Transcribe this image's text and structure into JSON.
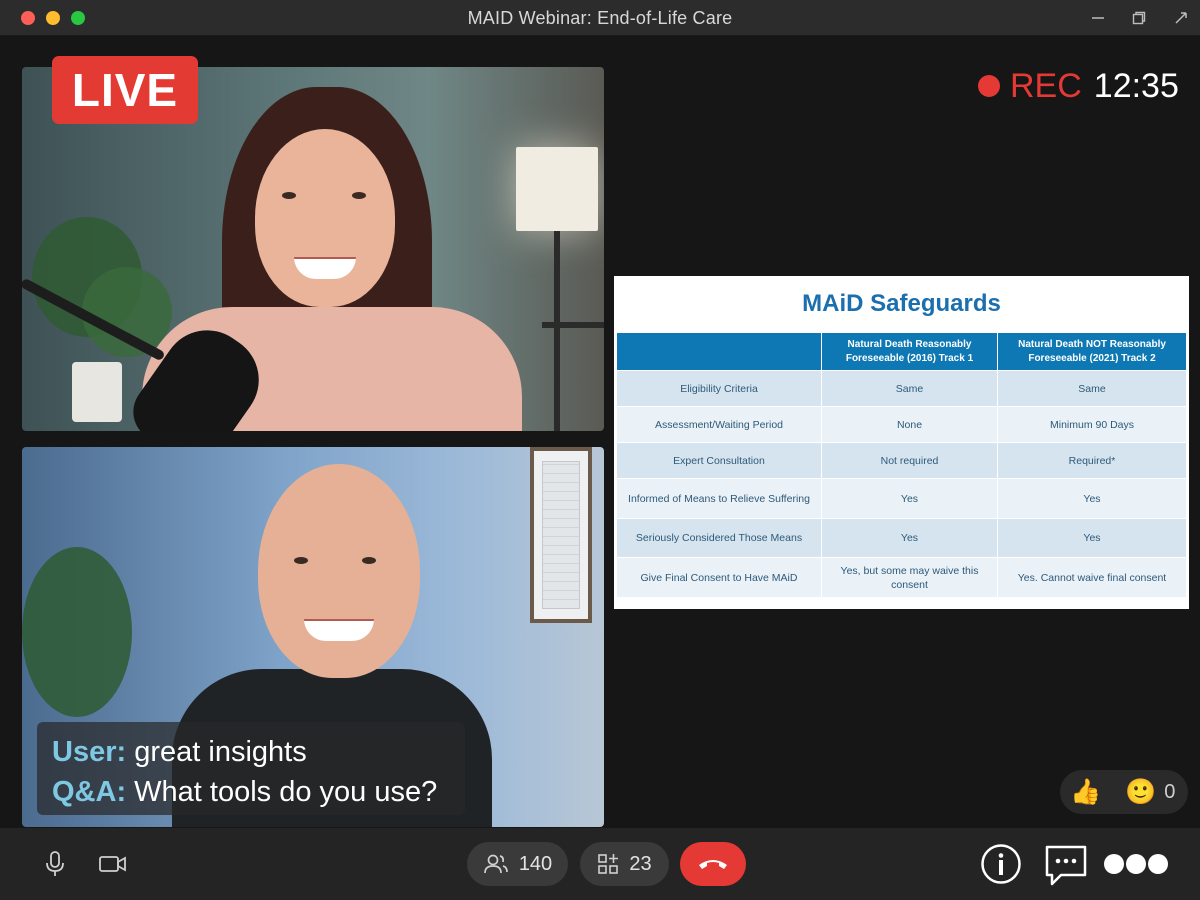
{
  "window": {
    "title": "MAID Webinar: End-of-Life Care"
  },
  "badges": {
    "live": "LIVE",
    "rec_label": "REC",
    "rec_time": "12:35"
  },
  "slide": {
    "title": "MAiD Safeguards",
    "columns": [
      "",
      "Natural Death Reasonably Foreseeable (2016) Track 1",
      "Natural Death NOT Reasonably Foreseeable (2021) Track 2"
    ],
    "rows": [
      [
        "Eligibility Criteria",
        "Same",
        "Same"
      ],
      [
        "Assessment/Waiting Period",
        "None",
        "Minimum 90 Days"
      ],
      [
        "Expert Consultation",
        "Not required",
        "Required*"
      ],
      [
        "Informed of Means to Relieve Suffering",
        "Yes",
        "Yes"
      ],
      [
        "Seriously Considered Those Means",
        "Yes",
        "Yes"
      ],
      [
        "Give Final Consent to Have MAiD",
        "Yes, but some may waive this consent",
        "Yes. Cannot waive final consent"
      ]
    ]
  },
  "captions": [
    {
      "name": "User:",
      "text": "great insights"
    },
    {
      "name": "Q&A:",
      "text": "What tools do you use?"
    }
  ],
  "reactions": {
    "thumbs": "👍",
    "smile": "🙂",
    "count": "0"
  },
  "controls": {
    "participants_count": "140",
    "apps_count": "23"
  },
  "icons": {
    "mic": "microphone-icon",
    "camera": "camera-icon",
    "participants": "people-icon",
    "apps": "apps-icon",
    "hangup": "phone-hangup-icon",
    "info": "info-icon",
    "chat": "chat-icon",
    "more": "more-icon"
  },
  "colors": {
    "live": "#e33b34",
    "rec": "#e53935",
    "slide_header": "#0e78b4",
    "slide_title": "#1b6fae",
    "caption_name": "#7ec8e3"
  }
}
